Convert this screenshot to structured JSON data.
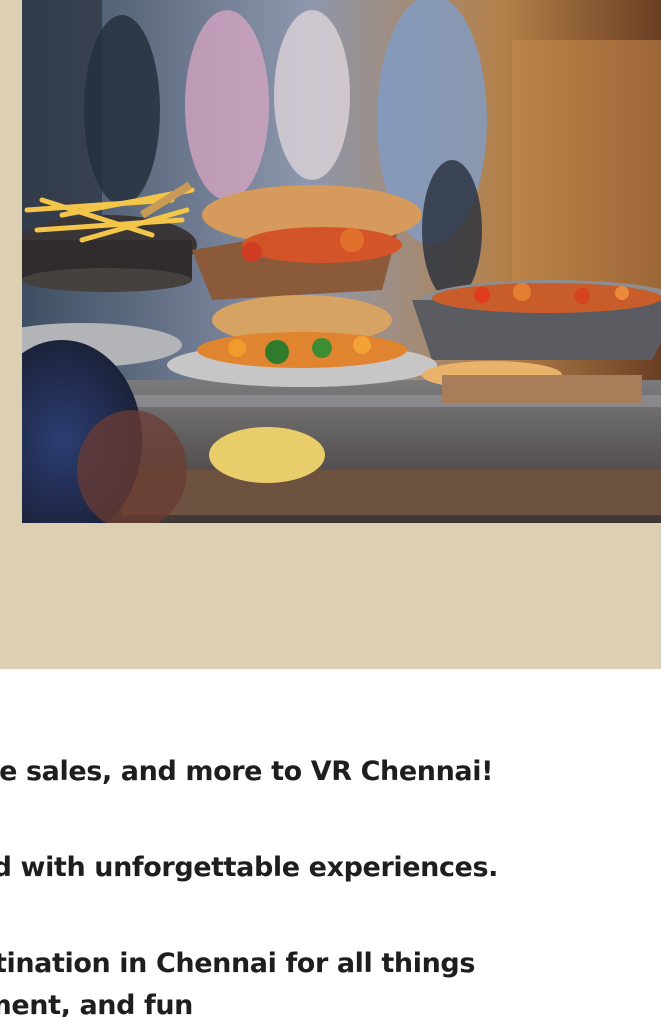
{
  "hero": {
    "image_description": "street-food-stall-photo"
  },
  "content": {
    "lines": [
      "sive sales, and more to VR Chennai!",
      "lled with unforgettable experiences.",
      "estination in Chennai for all things",
      "ment, and fun"
    ]
  },
  "colors": {
    "band": "#dccfb2",
    "text": "#1e1e1e",
    "background": "#ffffff"
  }
}
